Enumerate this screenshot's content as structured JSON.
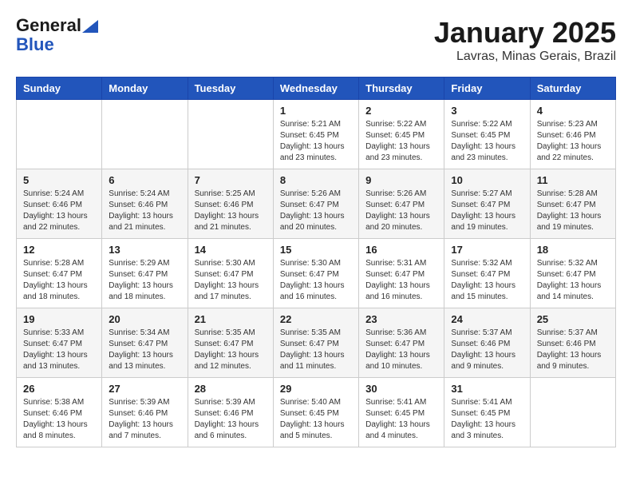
{
  "header": {
    "logo_line1": "General",
    "logo_line2": "Blue",
    "month": "January 2025",
    "location": "Lavras, Minas Gerais, Brazil"
  },
  "weekdays": [
    "Sunday",
    "Monday",
    "Tuesday",
    "Wednesday",
    "Thursday",
    "Friday",
    "Saturday"
  ],
  "weeks": [
    [
      {
        "day": "",
        "info": ""
      },
      {
        "day": "",
        "info": ""
      },
      {
        "day": "",
        "info": ""
      },
      {
        "day": "1",
        "info": "Sunrise: 5:21 AM\nSunset: 6:45 PM\nDaylight: 13 hours\nand 23 minutes."
      },
      {
        "day": "2",
        "info": "Sunrise: 5:22 AM\nSunset: 6:45 PM\nDaylight: 13 hours\nand 23 minutes."
      },
      {
        "day": "3",
        "info": "Sunrise: 5:22 AM\nSunset: 6:45 PM\nDaylight: 13 hours\nand 23 minutes."
      },
      {
        "day": "4",
        "info": "Sunrise: 5:23 AM\nSunset: 6:46 PM\nDaylight: 13 hours\nand 22 minutes."
      }
    ],
    [
      {
        "day": "5",
        "info": "Sunrise: 5:24 AM\nSunset: 6:46 PM\nDaylight: 13 hours\nand 22 minutes."
      },
      {
        "day": "6",
        "info": "Sunrise: 5:24 AM\nSunset: 6:46 PM\nDaylight: 13 hours\nand 21 minutes."
      },
      {
        "day": "7",
        "info": "Sunrise: 5:25 AM\nSunset: 6:46 PM\nDaylight: 13 hours\nand 21 minutes."
      },
      {
        "day": "8",
        "info": "Sunrise: 5:26 AM\nSunset: 6:47 PM\nDaylight: 13 hours\nand 20 minutes."
      },
      {
        "day": "9",
        "info": "Sunrise: 5:26 AM\nSunset: 6:47 PM\nDaylight: 13 hours\nand 20 minutes."
      },
      {
        "day": "10",
        "info": "Sunrise: 5:27 AM\nSunset: 6:47 PM\nDaylight: 13 hours\nand 19 minutes."
      },
      {
        "day": "11",
        "info": "Sunrise: 5:28 AM\nSunset: 6:47 PM\nDaylight: 13 hours\nand 19 minutes."
      }
    ],
    [
      {
        "day": "12",
        "info": "Sunrise: 5:28 AM\nSunset: 6:47 PM\nDaylight: 13 hours\nand 18 minutes."
      },
      {
        "day": "13",
        "info": "Sunrise: 5:29 AM\nSunset: 6:47 PM\nDaylight: 13 hours\nand 18 minutes."
      },
      {
        "day": "14",
        "info": "Sunrise: 5:30 AM\nSunset: 6:47 PM\nDaylight: 13 hours\nand 17 minutes."
      },
      {
        "day": "15",
        "info": "Sunrise: 5:30 AM\nSunset: 6:47 PM\nDaylight: 13 hours\nand 16 minutes."
      },
      {
        "day": "16",
        "info": "Sunrise: 5:31 AM\nSunset: 6:47 PM\nDaylight: 13 hours\nand 16 minutes."
      },
      {
        "day": "17",
        "info": "Sunrise: 5:32 AM\nSunset: 6:47 PM\nDaylight: 13 hours\nand 15 minutes."
      },
      {
        "day": "18",
        "info": "Sunrise: 5:32 AM\nSunset: 6:47 PM\nDaylight: 13 hours\nand 14 minutes."
      }
    ],
    [
      {
        "day": "19",
        "info": "Sunrise: 5:33 AM\nSunset: 6:47 PM\nDaylight: 13 hours\nand 13 minutes."
      },
      {
        "day": "20",
        "info": "Sunrise: 5:34 AM\nSunset: 6:47 PM\nDaylight: 13 hours\nand 13 minutes."
      },
      {
        "day": "21",
        "info": "Sunrise: 5:35 AM\nSunset: 6:47 PM\nDaylight: 13 hours\nand 12 minutes."
      },
      {
        "day": "22",
        "info": "Sunrise: 5:35 AM\nSunset: 6:47 PM\nDaylight: 13 hours\nand 11 minutes."
      },
      {
        "day": "23",
        "info": "Sunrise: 5:36 AM\nSunset: 6:47 PM\nDaylight: 13 hours\nand 10 minutes."
      },
      {
        "day": "24",
        "info": "Sunrise: 5:37 AM\nSunset: 6:46 PM\nDaylight: 13 hours\nand 9 minutes."
      },
      {
        "day": "25",
        "info": "Sunrise: 5:37 AM\nSunset: 6:46 PM\nDaylight: 13 hours\nand 9 minutes."
      }
    ],
    [
      {
        "day": "26",
        "info": "Sunrise: 5:38 AM\nSunset: 6:46 PM\nDaylight: 13 hours\nand 8 minutes."
      },
      {
        "day": "27",
        "info": "Sunrise: 5:39 AM\nSunset: 6:46 PM\nDaylight: 13 hours\nand 7 minutes."
      },
      {
        "day": "28",
        "info": "Sunrise: 5:39 AM\nSunset: 6:46 PM\nDaylight: 13 hours\nand 6 minutes."
      },
      {
        "day": "29",
        "info": "Sunrise: 5:40 AM\nSunset: 6:45 PM\nDaylight: 13 hours\nand 5 minutes."
      },
      {
        "day": "30",
        "info": "Sunrise: 5:41 AM\nSunset: 6:45 PM\nDaylight: 13 hours\nand 4 minutes."
      },
      {
        "day": "31",
        "info": "Sunrise: 5:41 AM\nSunset: 6:45 PM\nDaylight: 13 hours\nand 3 minutes."
      },
      {
        "day": "",
        "info": ""
      }
    ]
  ]
}
